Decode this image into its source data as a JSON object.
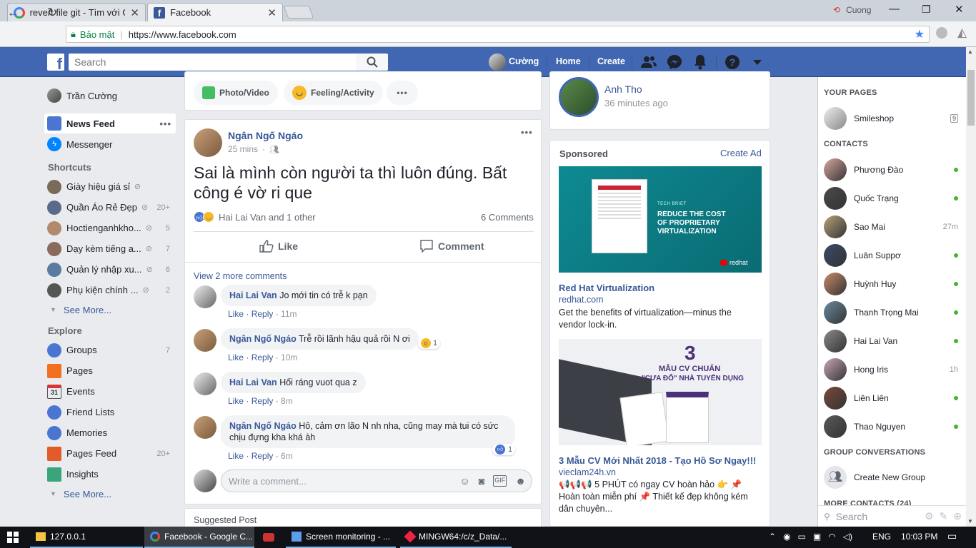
{
  "browser": {
    "tabs": [
      {
        "title": "revert file git - Tìm với Gc"
      },
      {
        "title": "Facebook"
      }
    ],
    "profile_name": "Cuong",
    "secure_label": "Bảo mật",
    "url": "https://www.facebook.com"
  },
  "fb_header": {
    "search_placeholder": "Search",
    "user_name": "Cường",
    "home": "Home",
    "create": "Create"
  },
  "left_nav": {
    "user": "Trần Cường",
    "news_feed": "News Feed",
    "messenger": "Messenger",
    "shortcuts_title": "Shortcuts",
    "shortcuts": [
      {
        "label": "Giày hiệu giá sỉ",
        "count": ""
      },
      {
        "label": "Quần Áo Rẻ Đẹp",
        "count": "20+"
      },
      {
        "label": "Hoctienganhkho...",
        "count": "5"
      },
      {
        "label": "Dạy kèm tiếng a...",
        "count": "7"
      },
      {
        "label": "Quản lý nhập xu...",
        "count": "6"
      },
      {
        "label": "Phụ kiện chính ...",
        "count": "2"
      }
    ],
    "see_more": "See More...",
    "explore_title": "Explore",
    "explore": [
      {
        "label": "Groups",
        "count": "7"
      },
      {
        "label": "Pages",
        "count": ""
      },
      {
        "label": "Events",
        "count": ""
      },
      {
        "label": "Friend Lists",
        "count": ""
      },
      {
        "label": "Memories",
        "count": ""
      },
      {
        "label": "Pages Feed",
        "count": "20+"
      },
      {
        "label": "Insights",
        "count": ""
      }
    ],
    "events_day": "31"
  },
  "composer": {
    "photo_video": "Photo/Video",
    "feeling_activity": "Feeling/Activity"
  },
  "post": {
    "author": "Ngân Ngố Ngáo",
    "time": "25 mins",
    "text": "Sai là mình còn người ta thì luôn đúng. Bất công é vờ ri que",
    "reactions": "Hai Lai Van and 1 other",
    "comments_count": "6 Comments",
    "like": "Like",
    "comment": "Comment",
    "view_more": "View 2 more comments",
    "comments": [
      {
        "author": "Hai Lai Van",
        "text": "Jo mới tin có trễ k pạn",
        "time": "11m",
        "reaction_count": ""
      },
      {
        "author": "Ngân Ngố Ngáo",
        "text": "Trễ rồi lãnh hậu quả rồi N ơi",
        "time": "10m",
        "reaction_count": "1"
      },
      {
        "author": "Hai Lai Van",
        "text": "Hối ráng vuot qua z",
        "time": "8m",
        "reaction_count": ""
      },
      {
        "author": "Ngân Ngố Ngáo",
        "text": "Hô, cảm ơn lão N nh nha, cũng may mà tui có sức chịu đựng kha khá àh",
        "time": "6m",
        "reaction_count": "1"
      }
    ],
    "comment_like": "Like",
    "comment_reply": "Reply",
    "write_placeholder": "Write a comment..."
  },
  "suggested_post": "Suggested Post",
  "story": {
    "name": "Anh Tho",
    "time": "36 minutes ago"
  },
  "sponsored": {
    "title": "Sponsored",
    "create_ad": "Create Ad",
    "ads": [
      {
        "image_lines": [
          "TECH BRIEF",
          "REDUCE THE COST",
          "OF PROPRIETARY",
          "VIRTUALIZATION"
        ],
        "brand_mark": "redhat",
        "title": "Red Hat Virtualization",
        "domain": "redhat.com",
        "desc": "Get the benefits of virtualization—minus the vendor lock-in."
      },
      {
        "image_lines": [
          "3",
          "MẪU CV CHUẨN",
          "\"CƯA ĐỔ\" NHÀ TUYỂN DỤNG"
        ],
        "title": "3 Mẫu CV Mới Nhất 2018 - Tạo Hồ Sơ Ngay!!!",
        "domain": "vieclam24h.vn",
        "desc": "📢📢📢 5 PHÚT có ngay CV hoàn hảo 👉 📌 Hoàn toàn miễn phí 📌 Thiết kế đẹp không kém dân chuyên..."
      }
    ]
  },
  "right_sidebar": {
    "your_pages_title": "YOUR PAGES",
    "page_name": "Smileshop",
    "page_badge": "9",
    "contacts_title": "CONTACTS",
    "contacts": [
      {
        "name": "Phương Đào",
        "status": "online"
      },
      {
        "name": "Quốc Trạng",
        "status": "online"
      },
      {
        "name": "Sao Mai",
        "status": "27m"
      },
      {
        "name": "Luân Suppơ",
        "status": "online"
      },
      {
        "name": "Huỳnh Huy",
        "status": "online"
      },
      {
        "name": "Thanh Trọng Mai",
        "status": "online"
      },
      {
        "name": "Hai Lai Van",
        "status": "online"
      },
      {
        "name": "Hong Iris",
        "status": "1h"
      },
      {
        "name": "Liên Liên",
        "status": "online"
      },
      {
        "name": "Thao Nguyen",
        "status": "online"
      }
    ],
    "group_conv_title": "GROUP CONVERSATIONS",
    "create_group": "Create New Group",
    "more_contacts": "MORE CONTACTS (24)",
    "search_placeholder": "Search"
  },
  "taskbar": {
    "items": [
      "127.0.0.1",
      "Facebook - Google C...",
      "Screen monitoring - ...",
      "MINGW64:/c/z_Data/..."
    ],
    "lang": "ENG",
    "time": "10:03 PM"
  },
  "colors": {
    "fb_blue": "#4267b2",
    "link": "#385898",
    "online": "#42b72a"
  }
}
